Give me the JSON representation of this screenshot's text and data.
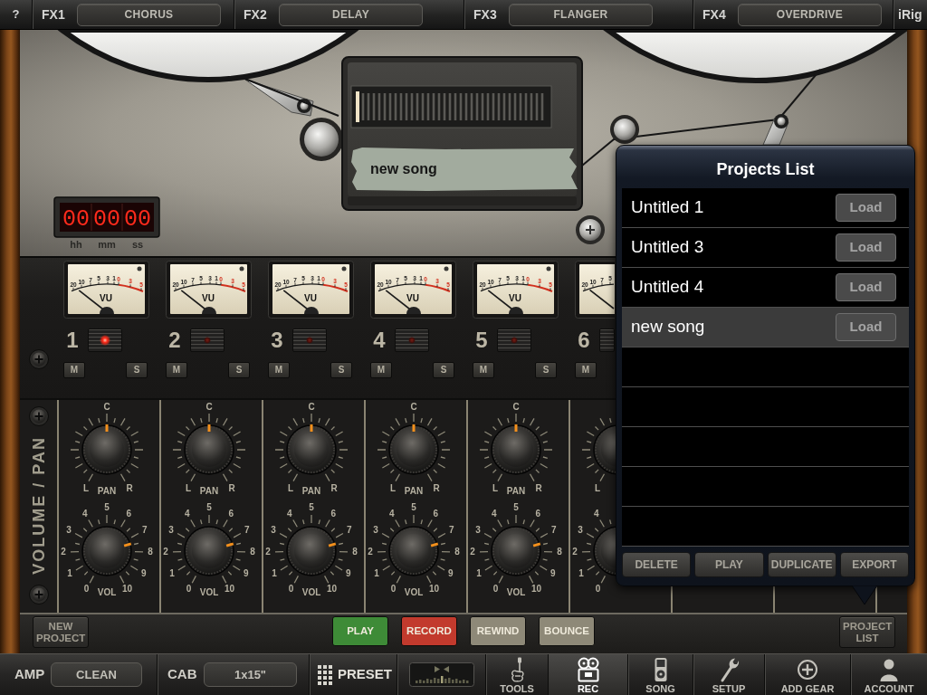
{
  "fx_bar": {
    "help": "?",
    "slots": [
      {
        "label": "FX1",
        "effect": "CHORUS"
      },
      {
        "label": "FX2",
        "effect": "DELAY"
      },
      {
        "label": "FX3",
        "effect": "FLANGER"
      },
      {
        "label": "FX4",
        "effect": "OVERDRIVE"
      }
    ],
    "brand": "iRig"
  },
  "deck": {
    "tape_label": "new song",
    "tape_meter": {
      "level": 0
    },
    "counter": [
      {
        "value": "00",
        "unit": "hh"
      },
      {
        "value": "00",
        "unit": "mm"
      },
      {
        "value": "00",
        "unit": "ss"
      }
    ]
  },
  "channels": [
    {
      "kind": "full",
      "number": "1",
      "armed": true,
      "meter": {
        "scale": [
          "20",
          "10",
          "7",
          "5",
          "3",
          "1",
          "0",
          "3",
          "5"
        ],
        "label": "VU"
      },
      "mute": "M",
      "solo": "S",
      "pan": {
        "center": "C",
        "left": "L",
        "label": "PAN",
        "right": "R"
      },
      "volume": {
        "scale": [
          "0",
          "1",
          "2",
          "3",
          "4",
          "5",
          "6",
          "7",
          "8",
          "9",
          "10"
        ],
        "label": "VOL"
      }
    },
    {
      "kind": "full",
      "number": "2",
      "armed": false,
      "meter": {
        "scale": [
          "20",
          "10",
          "7",
          "5",
          "3",
          "1",
          "0",
          "3",
          "5"
        ],
        "label": "VU"
      },
      "mute": "M",
      "solo": "S",
      "pan": {
        "center": "C",
        "left": "L",
        "label": "PAN",
        "right": "R"
      },
      "volume": {
        "scale": [
          "0",
          "1",
          "2",
          "3",
          "4",
          "5",
          "6",
          "7",
          "8",
          "9",
          "10"
        ],
        "label": "VOL"
      }
    },
    {
      "kind": "full",
      "number": "3",
      "armed": false,
      "meter": {
        "scale": [
          "20",
          "10",
          "7",
          "5",
          "3",
          "1",
          "0",
          "3",
          "5"
        ],
        "label": "VU"
      },
      "mute": "M",
      "solo": "S",
      "pan": {
        "center": "C",
        "left": "L",
        "label": "PAN",
        "right": "R"
      },
      "volume": {
        "scale": [
          "0",
          "1",
          "2",
          "3",
          "4",
          "5",
          "6",
          "7",
          "8",
          "9",
          "10"
        ],
        "label": "VOL"
      }
    },
    {
      "kind": "full",
      "number": "4",
      "armed": false,
      "meter": {
        "scale": [
          "20",
          "10",
          "7",
          "5",
          "3",
          "1",
          "0",
          "3",
          "5"
        ],
        "label": "VU"
      },
      "mute": "M",
      "solo": "S",
      "pan": {
        "center": "C",
        "left": "L",
        "label": "PAN",
        "right": "R"
      },
      "volume": {
        "scale": [
          "0",
          "1",
          "2",
          "3",
          "4",
          "5",
          "6",
          "7",
          "8",
          "9",
          "10"
        ],
        "label": "VOL"
      }
    },
    {
      "kind": "full",
      "number": "5",
      "armed": false,
      "meter": {
        "scale": [
          "20",
          "10",
          "7",
          "5",
          "3",
          "1",
          "0",
          "3",
          "5"
        ],
        "label": "VU"
      },
      "mute": "M",
      "solo": "S",
      "pan": {
        "center": "C",
        "left": "L",
        "label": "PAN",
        "right": "R"
      },
      "volume": {
        "scale": [
          "0",
          "1",
          "2",
          "3",
          "4",
          "5",
          "6",
          "7",
          "8",
          "9",
          "10"
        ],
        "label": "VOL"
      }
    },
    {
      "kind": "partial",
      "number": "6",
      "meter": {
        "scale": [
          "20",
          "10",
          "7",
          "5"
        ]
      },
      "mute": "M",
      "pan": {
        "left": "L"
      },
      "volume": {
        "scale": [
          "0",
          "1",
          "2",
          "3",
          "4"
        ]
      }
    }
  ],
  "panel_label": "VOLUME / PAN",
  "transport": {
    "new_project": "NEW PROJECT",
    "controls": [
      {
        "label": "PLAY",
        "color": "#3e8b37"
      },
      {
        "label": "RECORD",
        "color": "#c23a2d"
      },
      {
        "label": "REWIND",
        "color": "#8e8978"
      },
      {
        "label": "BOUNCE",
        "color": "#8e8978"
      }
    ],
    "project_list": "PROJECT LIST"
  },
  "projects": {
    "title": "Projects List",
    "items": [
      {
        "name": "Untitled 1",
        "action": "Load",
        "selected": false
      },
      {
        "name": "Untitled 3",
        "action": "Load",
        "selected": false
      },
      {
        "name": "Untitled 4",
        "action": "Load",
        "selected": false
      },
      {
        "name": "new song",
        "action": "Load",
        "selected": true
      }
    ],
    "actions": [
      "DELETE",
      "PLAY",
      "DUPLICATE",
      "EXPORT"
    ]
  },
  "bottom_bar": {
    "amp": {
      "label": "AMP",
      "value": "CLEAN"
    },
    "cab": {
      "label": "CAB",
      "value": "1x15\""
    },
    "preset": "PRESET",
    "tabs": [
      {
        "label": "TOOLS",
        "kind": "tools",
        "selected": false
      },
      {
        "label": "REC",
        "kind": "recorder",
        "selected": true
      },
      {
        "label": "SONG",
        "kind": "player",
        "selected": false
      },
      {
        "label": "SETUP",
        "kind": "setup",
        "selected": false
      },
      {
        "label": "ADD GEAR",
        "kind": "add",
        "selected": false
      },
      {
        "label": "ACCOUNT",
        "kind": "account",
        "selected": false
      }
    ]
  }
}
